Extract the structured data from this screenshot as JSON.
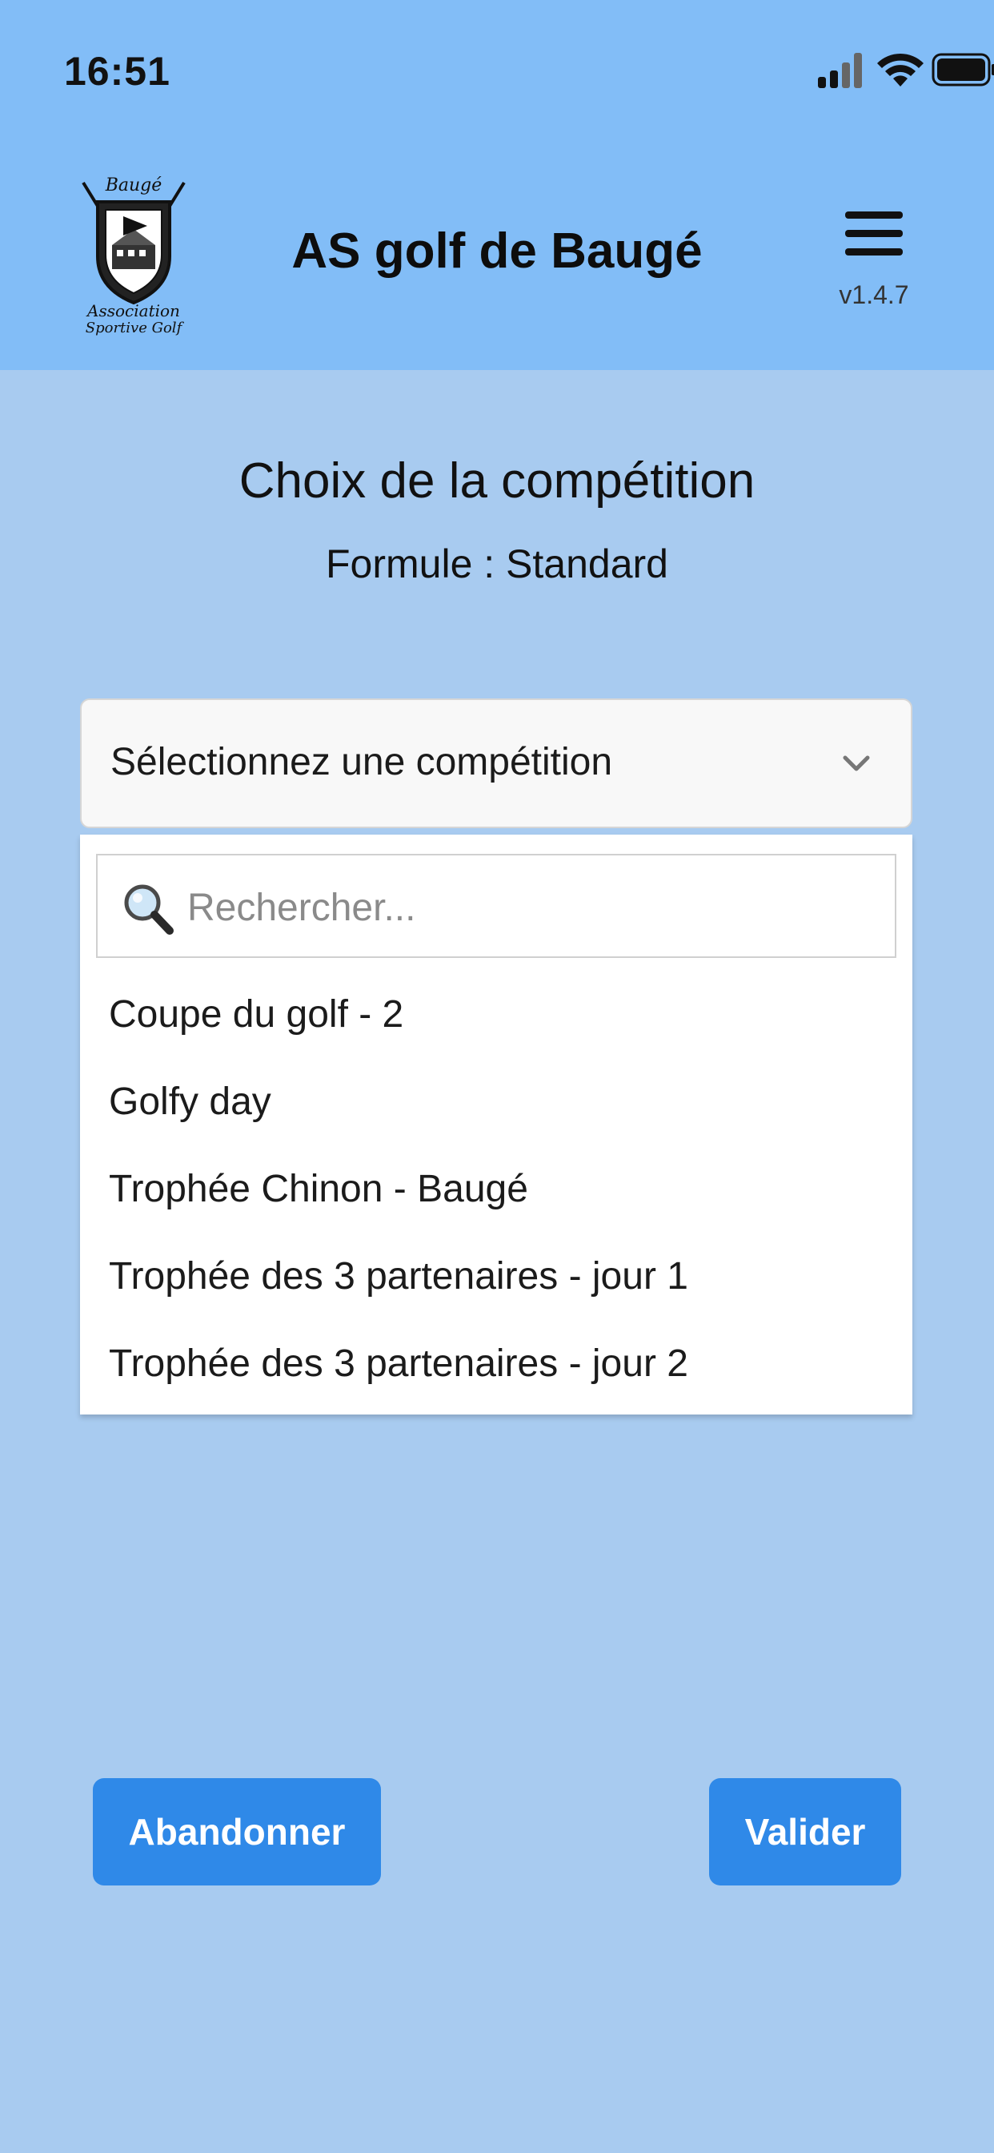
{
  "status_bar": {
    "time": "16:51"
  },
  "header": {
    "title": "AS golf de Baugé",
    "version": "v1.4.7",
    "logo_alt": "Baugé Association Sportive Golf",
    "logo_text_top": "Baugé",
    "logo_text_bottom_1": "Association",
    "logo_text_bottom_2": "Sportive Golf"
  },
  "content": {
    "title": "Choix de la compétition",
    "subtitle": "Formule : Standard"
  },
  "select": {
    "value": "Sélectionnez une compétition"
  },
  "dropdown": {
    "search_placeholder": "Rechercher...",
    "options": [
      "Coupe du golf - 2",
      "Golfy day",
      "Trophée Chinon - Baugé",
      "Trophée des 3 partenaires - jour 1",
      "Trophée des 3 partenaires - jour 2"
    ]
  },
  "buttons": {
    "abandon": "Abandonner",
    "validate": "Valider"
  },
  "colors": {
    "header_bg": "#82bdf7",
    "page_bg": "#a8cbf0",
    "button_bg": "#2f89e8"
  }
}
